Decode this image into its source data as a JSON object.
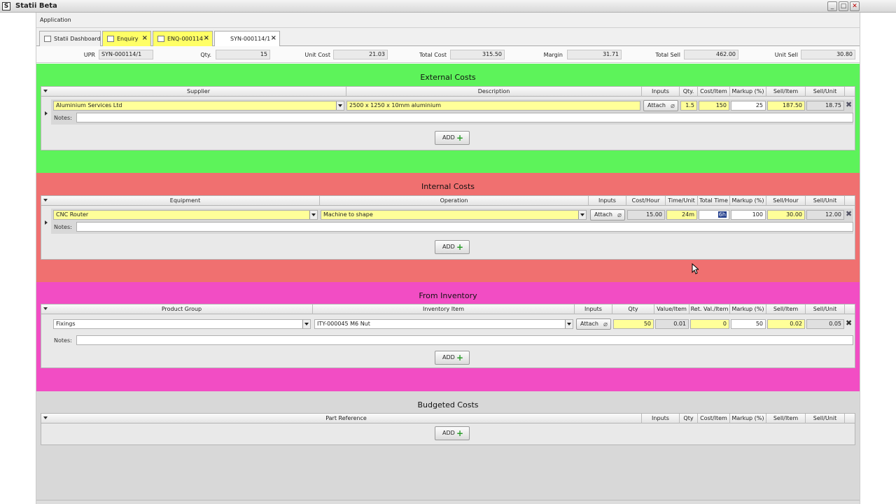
{
  "window": {
    "title": "Statii Beta",
    "icon_letter": "S"
  },
  "menu": {
    "application": "Application"
  },
  "tabs": [
    {
      "label": "Statii Dashboard"
    },
    {
      "label": "Enquiry"
    },
    {
      "label": "ENQ-000114"
    },
    {
      "label": "SYN-000114/1"
    }
  ],
  "summary": {
    "upr_label": "UPR",
    "upr": "SYN-000114/1",
    "qty_label": "Qty.",
    "qty": "15",
    "unit_cost_label": "Unit Cost",
    "unit_cost": "21.03",
    "total_cost_label": "Total Cost",
    "total_cost": "315.50",
    "margin_label": "Margin",
    "margin": "31.71",
    "total_sell_label": "Total Sell",
    "total_sell": "462.00",
    "unit_sell_label": "Unit Sell",
    "unit_sell": "30.80"
  },
  "colors": {
    "external": "#5df35a",
    "internal": "#f07070",
    "inventory": "#f24dc4",
    "budgeted": "#d8d8d8"
  },
  "notes_label": "Notes:",
  "add_label": "ADD",
  "attach_label": "Attach",
  "external": {
    "title": "External Costs",
    "headers": [
      "Supplier",
      "Description",
      "Inputs",
      "Qty.",
      "Cost/Item",
      "Markup (%)",
      "Sell/Item",
      "Sell/Unit"
    ],
    "row": {
      "supplier": "Aluminium Services Ltd",
      "description": "2500 x 1250 x 10mm aluminium",
      "qty": "1.5",
      "cost_item": "150",
      "markup": "25",
      "sell_item": "187.50",
      "sell_unit": "18.75"
    }
  },
  "internal": {
    "title": "Internal Costs",
    "headers": [
      "Equipment",
      "Operation",
      "Inputs",
      "Cost/Hour",
      "Time/Unit",
      "Total Time",
      "Markup (%)",
      "Sell/Hour",
      "Sell/Unit"
    ],
    "row": {
      "equipment": "CNC Router",
      "operation": "Machine to shape",
      "cost_hour": "15.00",
      "time_unit": "24m",
      "total_time": "6h",
      "markup": "100",
      "sell_hour": "30.00",
      "sell_unit": "12.00"
    }
  },
  "inventory": {
    "title": "From Inventory",
    "headers": [
      "Product Group",
      "Inventory Item",
      "Inputs",
      "Qty",
      "Value/Item",
      "Ret. Val./Item",
      "Markup (%)",
      "Sell/Item",
      "Sell/Unit"
    ],
    "row": {
      "product_group": "Fixings",
      "item": "ITY-000045 M6 Nut",
      "qty": "50",
      "value_item": "0.01",
      "ret_val": "0",
      "markup": "50",
      "sell_item": "0.02",
      "sell_unit": "0.05"
    }
  },
  "budgeted": {
    "title": "Budgeted Costs",
    "headers": [
      "Part Reference",
      "Inputs",
      "Qty",
      "Cost/Item",
      "Markup (%)",
      "Sell/Item",
      "Sell/Unit"
    ]
  }
}
